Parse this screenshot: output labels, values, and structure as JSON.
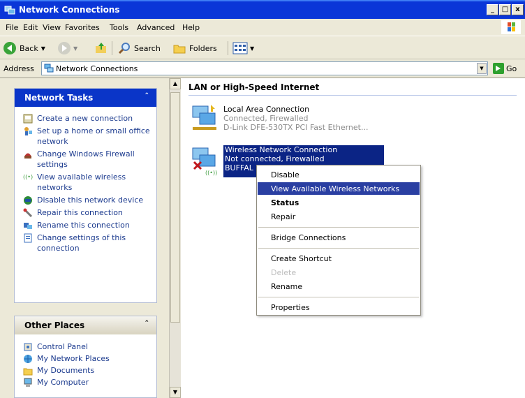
{
  "window": {
    "title": "Network Connections",
    "buttons": [
      "_",
      "□",
      "x"
    ]
  },
  "menu": [
    "File",
    "Edit",
    "View",
    "Favorites",
    "Tools",
    "Advanced",
    "Help"
  ],
  "toolbar": {
    "back": "Back",
    "search": "Search",
    "folders": "Folders"
  },
  "address": {
    "label": "Address",
    "value": "Network Connections",
    "go": "Go"
  },
  "network_tasks": {
    "title": "Network Tasks",
    "items": [
      {
        "label": "Create a new connection",
        "icon": "new-connection-icon"
      },
      {
        "label": "Set up a home or small office network",
        "icon": "home-network-icon"
      },
      {
        "label": "Change Windows Firewall settings",
        "icon": "firewall-icon"
      },
      {
        "label": "View available wireless networks",
        "icon": "wireless-icon"
      },
      {
        "label": "Disable this network device",
        "icon": "disable-device-icon"
      },
      {
        "label": "Repair this connection",
        "icon": "repair-icon"
      },
      {
        "label": "Rename this connection",
        "icon": "rename-icon"
      },
      {
        "label": "Change settings of this connection",
        "icon": "settings-icon"
      }
    ]
  },
  "other_places": {
    "title": "Other Places",
    "items": [
      {
        "label": "Control Panel",
        "icon": "control-panel-icon"
      },
      {
        "label": "My Network Places",
        "icon": "network-places-icon"
      },
      {
        "label": "My Documents",
        "icon": "documents-icon"
      },
      {
        "label": "My Computer",
        "icon": "computer-icon"
      }
    ]
  },
  "section_title": "LAN or High-Speed Internet",
  "connections": [
    {
      "name": "Local Area Connection",
      "status": "Connected, Firewalled",
      "device": "D-Link DFE-530TX PCI Fast Ethernet..."
    },
    {
      "name": "Wireless Network Connection",
      "status": "Not connected, Firewalled",
      "device": "BUFFAL"
    }
  ],
  "context_menu": [
    {
      "label": "Disable"
    },
    {
      "label": "View Available Wireless Networks",
      "highlighted": true
    },
    {
      "label": "Status",
      "bold": true
    },
    {
      "label": "Repair"
    },
    {
      "label": "Bridge Connections"
    },
    {
      "label": "Create Shortcut"
    },
    {
      "label": "Delete",
      "disabled": true
    },
    {
      "label": "Rename"
    },
    {
      "label": "Properties"
    }
  ],
  "colors": {
    "title_bar": "#0a36d8",
    "task_header": "#0a35c8",
    "selection": "#0b2485",
    "menu_highlight": "#2a3fa2"
  }
}
